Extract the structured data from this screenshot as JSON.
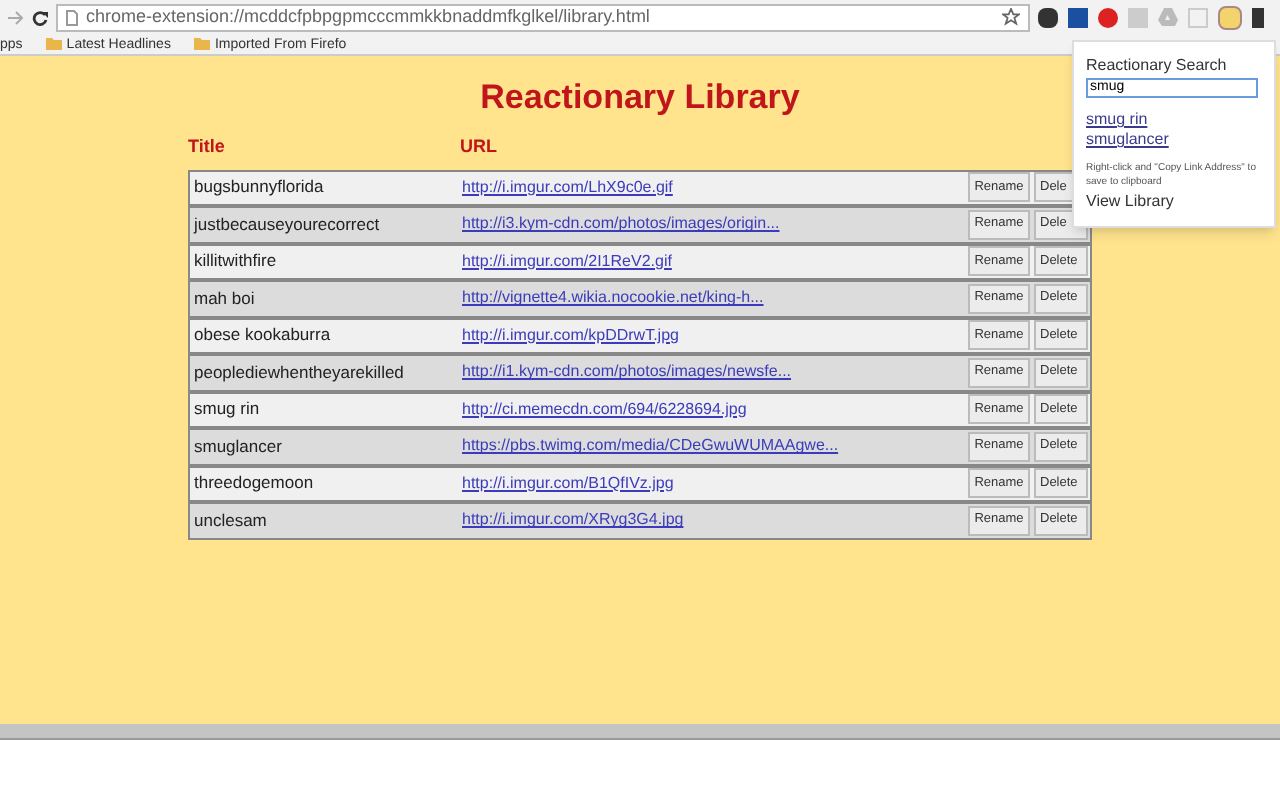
{
  "browser": {
    "address": "chrome-extension://mcddcfpbpgpmcccmmkkbnaddmfkglkel/library.html",
    "bookmarks": [
      {
        "label": "pps",
        "kind": "apps"
      },
      {
        "label": "Latest Headlines",
        "kind": "folder"
      },
      {
        "label": "Imported From Firefo",
        "kind": "folder"
      }
    ]
  },
  "library": {
    "title": "Reactionary Library",
    "columns": [
      "Title",
      "URL"
    ],
    "rows": [
      {
        "title": "bugsbunnyflorida",
        "url": "http://i.imgur.com/LhX9c0e.gif",
        "rename": "Rename",
        "delete": "Dele"
      },
      {
        "title": "justbecauseyourecorrect",
        "url": "http://i3.kym-cdn.com/photos/images/origin...",
        "rename": "Rename",
        "delete": "Dele"
      },
      {
        "title": "killitwithfire",
        "url": "http://i.imgur.com/2I1ReV2.gif",
        "rename": "Rename",
        "delete": "Delete"
      },
      {
        "title": "mah boi",
        "url": "http://vignette4.wikia.nocookie.net/king-h...",
        "rename": "Rename",
        "delete": "Delete"
      },
      {
        "title": "obese kookaburra",
        "url": "http://i.imgur.com/kpDDrwT.jpg",
        "rename": "Rename",
        "delete": "Delete"
      },
      {
        "title": "peoplediewhentheyarekilled",
        "url": "http://i1.kym-cdn.com/photos/images/newsfe...",
        "rename": "Rename",
        "delete": "Delete"
      },
      {
        "title": "smug rin",
        "url": "http://ci.memecdn.com/694/6228694.jpg",
        "rename": "Rename",
        "delete": "Delete"
      },
      {
        "title": "smuglancer",
        "url": "https://pbs.twimg.com/media/CDeGwuWUMAAgwe...",
        "rename": "Rename",
        "delete": "Delete"
      },
      {
        "title": "threedogemoon",
        "url": "http://i.imgur.com/B1QfIVz.jpg",
        "rename": "Rename",
        "delete": "Delete"
      },
      {
        "title": "unclesam",
        "url": "http://i.imgur.com/XRyg3G4.jpg",
        "rename": "Rename",
        "delete": "Delete"
      }
    ]
  },
  "popup": {
    "title": "Reactionary Search",
    "search_value": "smug",
    "results": [
      "smug rin",
      "smuglancer"
    ],
    "hint": "Right-click and \"Copy Link Address\" to save to clipboard",
    "view_library": "View Library"
  }
}
